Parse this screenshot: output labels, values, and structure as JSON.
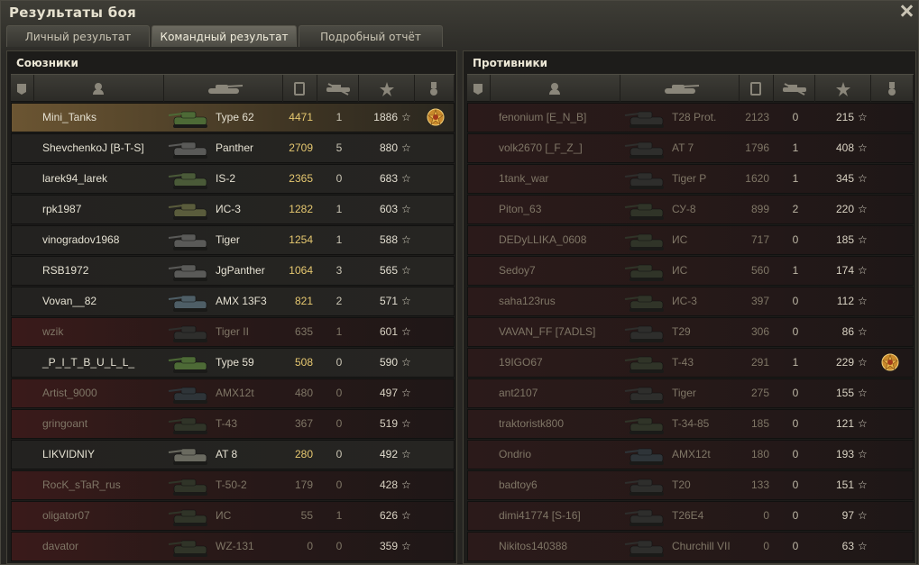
{
  "window": {
    "title": "Результаты боя"
  },
  "tabs": [
    {
      "label": "Личный результат"
    },
    {
      "label": "Командный результат"
    },
    {
      "label": "Подробный отчёт"
    }
  ],
  "allies": {
    "title": "Союзники",
    "rows": [
      {
        "player": "Mini_Tanks",
        "tank": "Type 62",
        "xp": "4471",
        "kills": "1",
        "score": "1886",
        "medal": true,
        "state": "mine",
        "tank_color": "#4d6a36"
      },
      {
        "player": "ShevchenkoJ [B-T-S]",
        "tank": "Panther",
        "xp": "2709",
        "kills": "5",
        "score": "880",
        "medal": false,
        "state": "alive",
        "tank_color": "#5a5a58"
      },
      {
        "player": "larek94_larek",
        "tank": "IS-2",
        "xp": "2365",
        "kills": "0",
        "score": "683",
        "medal": false,
        "state": "alive",
        "tank_color": "#4a5a38"
      },
      {
        "player": "rpk1987",
        "tank": "ИС-3",
        "xp": "1282",
        "kills": "1",
        "score": "603",
        "medal": false,
        "state": "alive",
        "tank_color": "#5a5c3c"
      },
      {
        "player": "vinogradov1968",
        "tank": "Tiger",
        "xp": "1254",
        "kills": "1",
        "score": "588",
        "medal": false,
        "state": "alive",
        "tank_color": "#5a5a58"
      },
      {
        "player": "RSB1972",
        "tank": "JgPanther",
        "xp": "1064",
        "kills": "3",
        "score": "565",
        "medal": false,
        "state": "alive",
        "tank_color": "#5a5a58"
      },
      {
        "player": "Vovan__82",
        "tank": "AMX 13F3",
        "xp": "821",
        "kills": "2",
        "score": "571",
        "medal": false,
        "state": "alive",
        "tank_color": "#4e5e66"
      },
      {
        "player": "wzik",
        "tank": "Tiger II",
        "xp": "635",
        "kills": "1",
        "score": "601",
        "medal": false,
        "state": "dead",
        "tank_color": "#2e2e2c"
      },
      {
        "player": "_P_I_T_B_U_L_L_",
        "tank": "Type 59",
        "xp": "508",
        "kills": "0",
        "score": "590",
        "medal": false,
        "state": "alive",
        "tank_color": "#4d6a36"
      },
      {
        "player": "Artist_9000",
        "tank": "AMX12t",
        "xp": "480",
        "kills": "0",
        "score": "497",
        "medal": false,
        "state": "dead",
        "tank_color": "#2e3438"
      },
      {
        "player": "gringoant",
        "tank": "T-43",
        "xp": "367",
        "kills": "0",
        "score": "519",
        "medal": false,
        "state": "dead",
        "tank_color": "#303428"
      },
      {
        "player": "LIKVIDNIY",
        "tank": "AT 8",
        "xp": "280",
        "kills": "0",
        "score": "492",
        "medal": false,
        "state": "alive",
        "tank_color": "#6a6a60"
      },
      {
        "player": "RocK_sTaR_rus",
        "tank": "T-50-2",
        "xp": "179",
        "kills": "0",
        "score": "428",
        "medal": false,
        "state": "dead",
        "tank_color": "#303428"
      },
      {
        "player": "oligator07",
        "tank": "ИС",
        "xp": "55",
        "kills": "1",
        "score": "626",
        "medal": false,
        "state": "dead",
        "tank_color": "#303428"
      },
      {
        "player": "davator",
        "tank": "WZ-131",
        "xp": "0",
        "kills": "0",
        "score": "359",
        "medal": false,
        "state": "dead",
        "tank_color": "#303428"
      }
    ]
  },
  "enemies": {
    "title": "Противники",
    "rows": [
      {
        "player": "fenonium [E_N_B]",
        "tank": "T28 Prot.",
        "xp": "2123",
        "kills": "0",
        "score": "215",
        "medal": false,
        "tank_color": "#2e2e2c"
      },
      {
        "player": "volk2670 [_F_Z_]",
        "tank": "AT 7",
        "xp": "1796",
        "kills": "1",
        "score": "408",
        "medal": false,
        "tank_color": "#2e2e2c"
      },
      {
        "player": "1tank_war",
        "tank": "Tiger P",
        "xp": "1620",
        "kills": "1",
        "score": "345",
        "medal": false,
        "tank_color": "#2e2e2c"
      },
      {
        "player": "Piton_63",
        "tank": "СУ-8",
        "xp": "899",
        "kills": "2",
        "score": "220",
        "medal": false,
        "tank_color": "#303428"
      },
      {
        "player": "DEDyLLIKA_0608",
        "tank": "ИС",
        "xp": "717",
        "kills": "0",
        "score": "185",
        "medal": false,
        "tank_color": "#303428"
      },
      {
        "player": "Sedoy7",
        "tank": "ИС",
        "xp": "560",
        "kills": "1",
        "score": "174",
        "medal": false,
        "tank_color": "#303428"
      },
      {
        "player": "saha123rus",
        "tank": "ИС-3",
        "xp": "397",
        "kills": "0",
        "score": "112",
        "medal": false,
        "tank_color": "#303428"
      },
      {
        "player": "VAVAN_FF [7ADLS]",
        "tank": "T29",
        "xp": "306",
        "kills": "0",
        "score": "86",
        "medal": false,
        "tank_color": "#2e2e2c"
      },
      {
        "player": "19IGO67",
        "tank": "T-43",
        "xp": "291",
        "kills": "1",
        "score": "229",
        "medal": true,
        "tank_color": "#303428"
      },
      {
        "player": "ant2107",
        "tank": "Tiger",
        "xp": "275",
        "kills": "0",
        "score": "155",
        "medal": false,
        "tank_color": "#2e2e2c"
      },
      {
        "player": "traktoristk800",
        "tank": "T-34-85",
        "xp": "185",
        "kills": "0",
        "score": "121",
        "medal": false,
        "tank_color": "#303428"
      },
      {
        "player": "Ondrio",
        "tank": "AMX12t",
        "xp": "180",
        "kills": "0",
        "score": "193",
        "medal": false,
        "tank_color": "#2e3438"
      },
      {
        "player": "badtoy6",
        "tank": "T20",
        "xp": "133",
        "kills": "0",
        "score": "151",
        "medal": false,
        "tank_color": "#2e2e2c"
      },
      {
        "player": "dimi41774 [S-16]",
        "tank": "T26E4",
        "xp": "0",
        "kills": "0",
        "score": "97",
        "medal": false,
        "tank_color": "#2e2e2c"
      },
      {
        "player": "Nikitos140388",
        "tank": "Churchill VII",
        "xp": "0",
        "kills": "0",
        "score": "63",
        "medal": false,
        "tank_color": "#2e2e2c"
      }
    ]
  },
  "header_icons": [
    "platoon-icon",
    "player-icon",
    "tank-icon",
    "xp-icon",
    "kills-icon",
    "score-star-icon",
    "medal-icon"
  ]
}
